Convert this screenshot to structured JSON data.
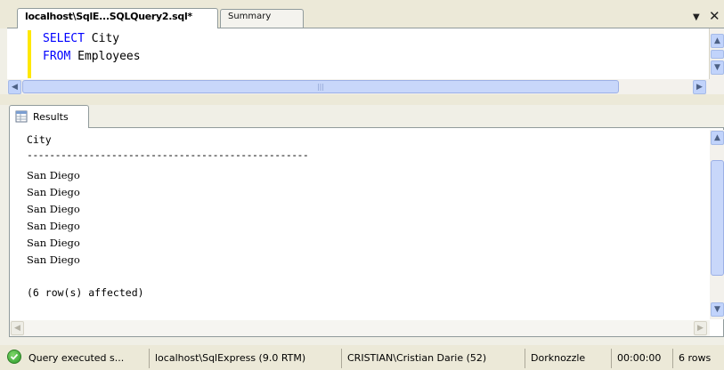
{
  "tabs": {
    "active_label": "localhost\\SqlE...SQLQuery2.sql*",
    "summary_label": "Summary"
  },
  "editor": {
    "line1_keyword": "SELECT",
    "line1_rest": " City",
    "line2_keyword": "FROM",
    "line2_rest": " Employees",
    "keyword_color": "#0000ff",
    "gutter_color": "#ffe800"
  },
  "results_tab": {
    "label": "Results",
    "column_header": "City",
    "separator": "--------------------------------------------------",
    "rows": [
      "San Diego",
      "San Diego",
      "San Diego",
      "San Diego",
      "San Diego",
      "San Diego"
    ],
    "affected": "(6 row(s) affected)"
  },
  "statusbar": {
    "status": "Query executed s...",
    "server": "localhost\\SqlExpress (9.0 RTM)",
    "user": "CRISTIAN\\Cristian Darie (52)",
    "database": "Dorknozzle",
    "elapsed": "00:00:00",
    "row_count": "6 rows"
  }
}
